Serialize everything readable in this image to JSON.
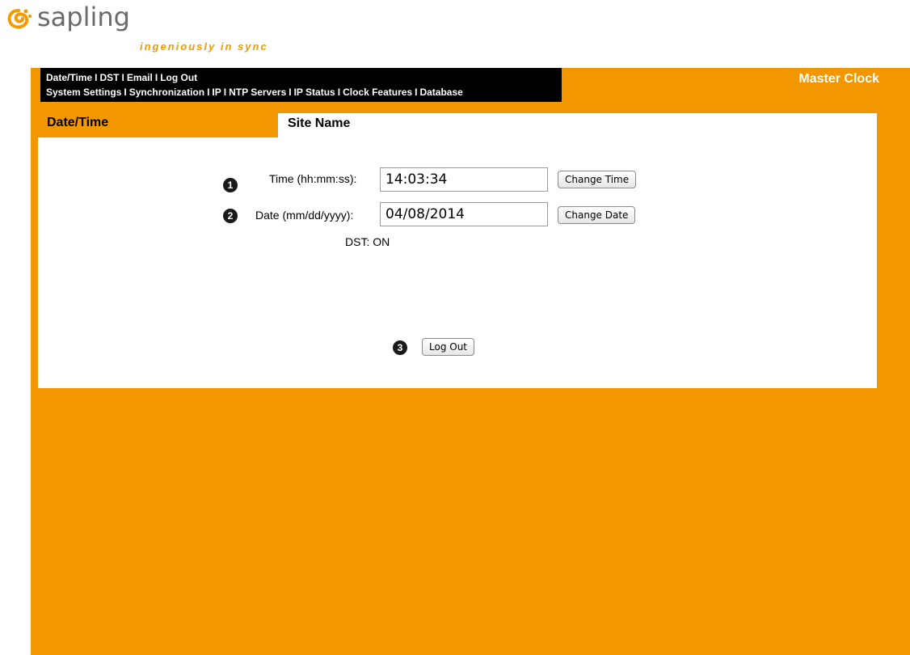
{
  "brand": {
    "name": "sapling",
    "tagline": "ingeniously in sync",
    "accent": "#f29700",
    "logo_color": "#f29a00"
  },
  "nav": {
    "row1": [
      "Date/Time",
      "DST",
      "Email",
      "Log Out"
    ],
    "row2": [
      "System Settings",
      "Synchronization",
      "IP",
      "NTP Servers",
      "IP Status",
      "Clock Features",
      "Database"
    ],
    "separator": "I"
  },
  "header": {
    "product": "Master Clock"
  },
  "tabs": {
    "active": "Date/Time",
    "site_name": "Site Name"
  },
  "form": {
    "time": {
      "label": "Time (hh:mm:ss):",
      "value": "14:03:34",
      "button": "Change Time",
      "badge": "1"
    },
    "date": {
      "label": "Date (mm/dd/yyyy):",
      "value": "04/08/2014",
      "button": "Change Date",
      "badge": "2"
    },
    "dst_status": "DST: ON",
    "logout": {
      "button": "Log Out",
      "badge": "3"
    }
  }
}
